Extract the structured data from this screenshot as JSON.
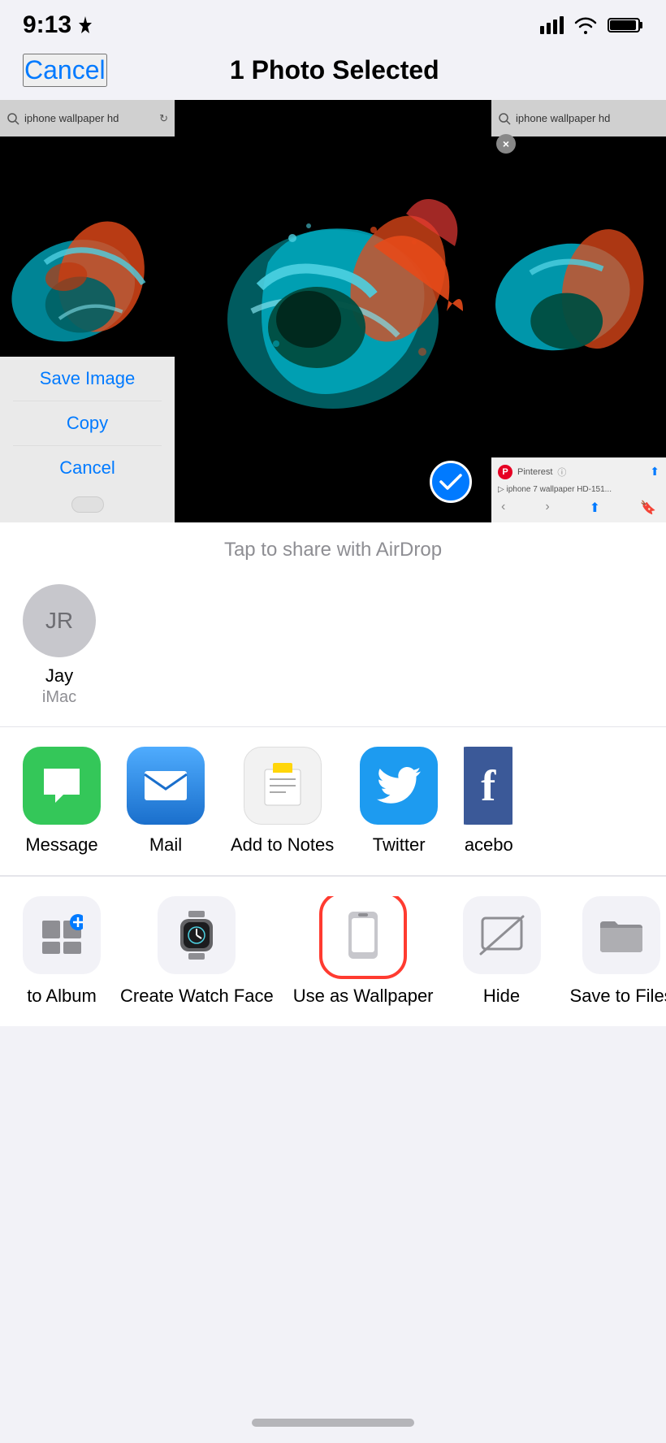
{
  "statusBar": {
    "time": "9:13",
    "locationIcon": "▶",
    "signalBars": [
      1,
      2,
      3,
      4
    ],
    "wifi": "wifi",
    "battery": "battery"
  },
  "nav": {
    "cancelLabel": "Cancel",
    "title": "1 Photo Selected"
  },
  "photos": {
    "airdropLabel": "Tap to share with AirDrop"
  },
  "contextMenu": {
    "saveImage": "Save Image",
    "copy": "Copy",
    "cancel": "Cancel"
  },
  "contact": {
    "initials": "JR",
    "name": "Jay",
    "device": "iMac"
  },
  "shareApps": [
    {
      "id": "message",
      "label": "Message",
      "bg": "#34c759",
      "color": "#fff",
      "icon": "💬"
    },
    {
      "id": "mail",
      "label": "Mail",
      "bg": "#1a8cff",
      "color": "#fff",
      "icon": "✉️"
    },
    {
      "id": "notes",
      "label": "Add to Notes",
      "bg": "#ffd60a",
      "color": "#000",
      "icon": "📝"
    },
    {
      "id": "twitter",
      "label": "Twitter",
      "bg": "#1d9bf0",
      "color": "#fff",
      "icon": "🐦"
    },
    {
      "id": "facebook",
      "label": "Facebook",
      "bg": "#3b5998",
      "color": "#fff",
      "icon": "f"
    }
  ],
  "actions": [
    {
      "id": "add-album",
      "label": "Add to Album",
      "icon": "grid-plus",
      "highlighted": false
    },
    {
      "id": "watch-face",
      "label": "Create Watch Face",
      "icon": "watch",
      "highlighted": false
    },
    {
      "id": "wallpaper",
      "label": "Use as Wallpaper",
      "icon": "phone",
      "highlighted": true
    },
    {
      "id": "hide",
      "label": "Hide",
      "icon": "hide",
      "highlighted": false
    },
    {
      "id": "save-files",
      "label": "Save to Files",
      "icon": "folder",
      "highlighted": false
    }
  ],
  "homeIndicator": {}
}
